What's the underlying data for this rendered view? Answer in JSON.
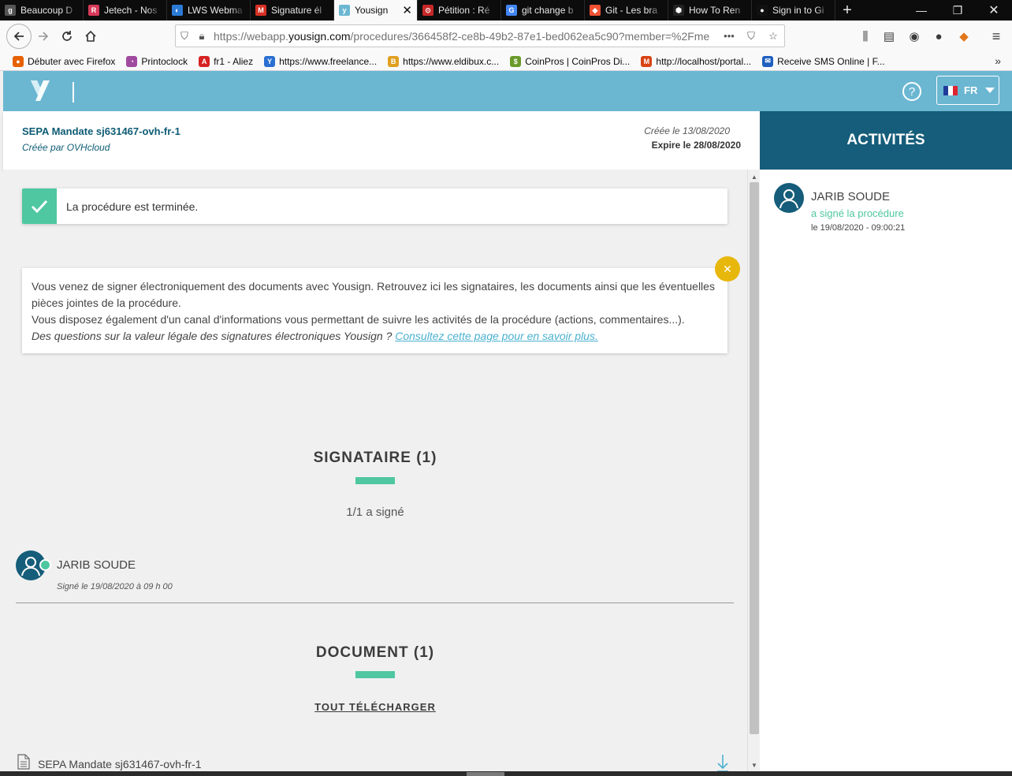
{
  "browser": {
    "tabs": [
      {
        "label": "Beaucoup D",
        "icon": "g-icon",
        "color": "#555555",
        "glyph": "g"
      },
      {
        "label": "Jetech - Nos",
        "icon": "jetech-icon",
        "color": "#d93a5a",
        "glyph": "R"
      },
      {
        "label": "LWS Webma",
        "icon": "lws-icon",
        "color": "#2b7bd6",
        "glyph": "◐"
      },
      {
        "label": "Signature él",
        "icon": "gmail-icon",
        "color": "#d93025",
        "glyph": "M"
      },
      {
        "label": "Yousign",
        "icon": "yousign-icon",
        "color": "#6bb7d2",
        "glyph": "y",
        "active": true
      },
      {
        "label": "Pétition : Ré",
        "icon": "petition-icon",
        "color": "#c62828",
        "glyph": "⊙"
      },
      {
        "label": "git change b",
        "icon": "google-icon",
        "color": "#4285f4",
        "glyph": "G"
      },
      {
        "label": "Git - Les bra",
        "icon": "git-icon",
        "color": "#f05133",
        "glyph": "◆"
      },
      {
        "label": "How To Ren",
        "icon": "hexagon-icon",
        "color": "#222222",
        "glyph": "⬢"
      },
      {
        "label": "Sign in to Gi",
        "icon": "github-icon",
        "color": "#111111",
        "glyph": "●"
      }
    ],
    "url_prefix": "https://webapp.",
    "url_domain": "yousign.com",
    "url_suffix": "/procedures/366458f2-ce8b-49b2-87e1-bed062ea5c90?member=%2Fme",
    "bookmarks": [
      {
        "label": "Débuter avec Firefox",
        "icon": "firefox-icon",
        "color": "#e66000",
        "glyph": "●"
      },
      {
        "label": "Printoclock",
        "icon": "printoclock-icon",
        "color": "#a04a9f",
        "glyph": "◔"
      },
      {
        "label": "fr1 - Aliez",
        "icon": "aliez-icon",
        "color": "#d62222",
        "glyph": "A"
      },
      {
        "label": "https://www.freelance...",
        "icon": "freelance-icon",
        "color": "#2a6fd1",
        "glyph": "Y"
      },
      {
        "label": "https://www.eldibux.c...",
        "icon": "eldibux-icon",
        "color": "#e0a020",
        "glyph": "B"
      },
      {
        "label": "CoinPros | CoinPros Di...",
        "icon": "coinpros-icon",
        "color": "#6a9a2a",
        "glyph": "$"
      },
      {
        "label": "http://localhost/portal...",
        "icon": "localhost-icon",
        "color": "#d84315",
        "glyph": "M"
      },
      {
        "label": "Receive SMS Online | F...",
        "icon": "sms-icon",
        "color": "#1e5fbf",
        "glyph": "✉"
      }
    ]
  },
  "header": {
    "lang": "FR"
  },
  "procedure": {
    "title": "SEPA Mandate sj631467-ovh-fr-1",
    "creator": "Créée par OVHcloud",
    "created": "Créée le 13/08/2020",
    "expires": "Expire le 28/08/2020"
  },
  "alert": {
    "text": "La procédure est terminée."
  },
  "info": {
    "line1": "Vous venez de signer électroniquement des documents avec Yousign. Retrouvez ici les signataires, les documents ainsi que les éventuelles pièces jointes de la procédure.",
    "line2": "Vous disposez également d'un canal d'informations vous permettant de suivre les activités de la procédure (actions, commentaires...).",
    "question": "Des questions sur la valeur légale des signatures électroniques Yousign ?",
    "link": "Consultez cette page pour en savoir plus."
  },
  "signers": {
    "title": "SIGNATAIRE (1)",
    "count": "1/1 a signé",
    "items": [
      {
        "name": "JARIB SOUDE",
        "date": "Signé le 19/08/2020 à 09 h 00"
      }
    ]
  },
  "documents": {
    "title": "DOCUMENT (1)",
    "download_all": "TOUT TÉLÉCHARGER",
    "items": [
      {
        "name": "SEPA Mandate sj631467-ovh-fr-1"
      }
    ]
  },
  "activities": {
    "title": "ACTIVITÉS",
    "items": [
      {
        "name": "JARIB SOUDE",
        "desc": "a signé la procédure",
        "time": "le 19/08/2020 - 09:00:21"
      }
    ]
  },
  "colors": {
    "header": "#6bb7d2",
    "dark_teal": "#155d7a",
    "green": "#4fc7a1",
    "yellow": "#e8b70c",
    "link": "#4ab1d1"
  }
}
